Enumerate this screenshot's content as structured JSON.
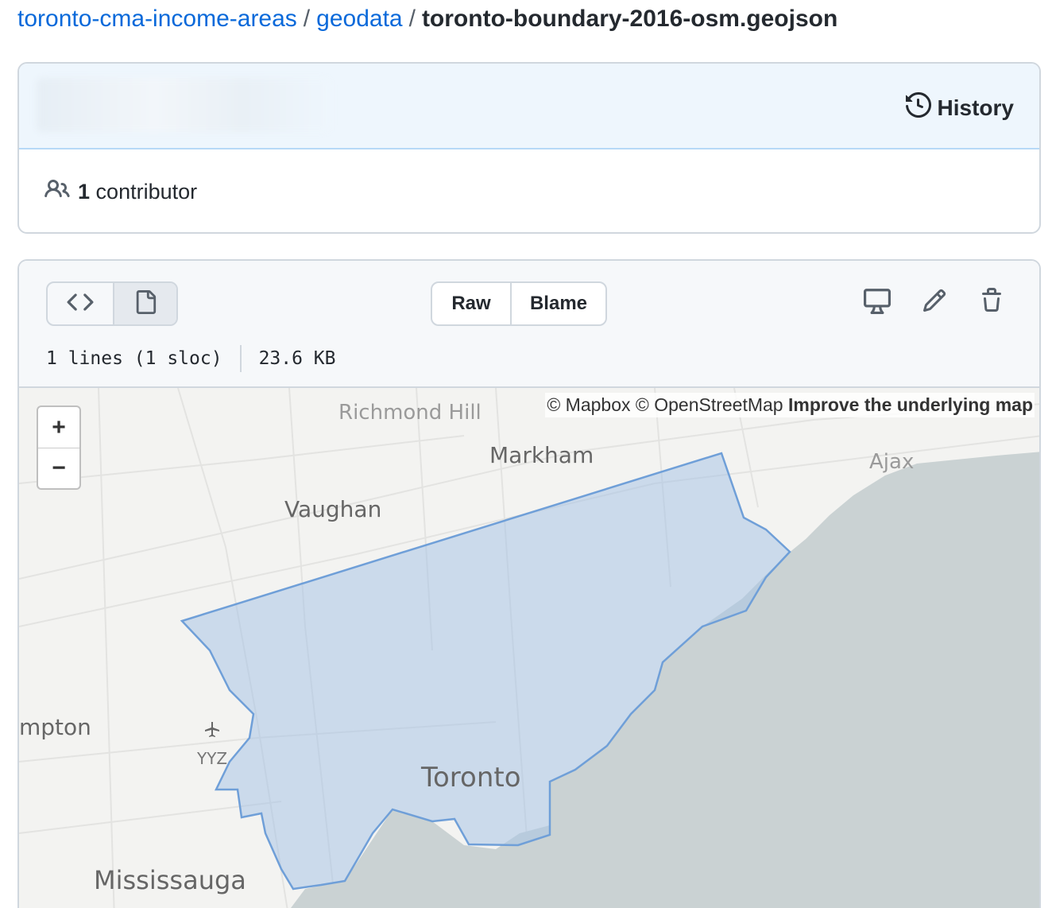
{
  "breadcrumb": {
    "repo": "toronto-cma-income-areas",
    "folder": "geodata",
    "file": "toronto-boundary-2016-osm.geojson",
    "separator": "/"
  },
  "commit": {
    "history_label": "History",
    "contributor_count": "1",
    "contributor_label": "contributor"
  },
  "file": {
    "raw_label": "Raw",
    "blame_label": "Blame",
    "lines_info": "1 lines (1 sloc)",
    "size": "23.6 KB"
  },
  "map": {
    "zoom_in": "+",
    "zoom_out": "−",
    "attribution_mapbox": "© Mapbox",
    "attribution_osm": "© OpenStreetMap",
    "attribution_improve": "Improve the underlying map",
    "places": {
      "richmond_hill": "Richmond Hill",
      "markham": "Markham",
      "ajax": "Ajax",
      "vaughan": "Vaughan",
      "brampton": "mpton",
      "yyz": "YYZ",
      "toronto": "Toronto",
      "mississauga": "Mississauga"
    }
  },
  "colors": {
    "link": "#0969da",
    "polygon_fill": "#a9c4e6",
    "polygon_stroke": "#6f9fd8",
    "water": "#cad2d3",
    "land": "#f3f3f1"
  }
}
